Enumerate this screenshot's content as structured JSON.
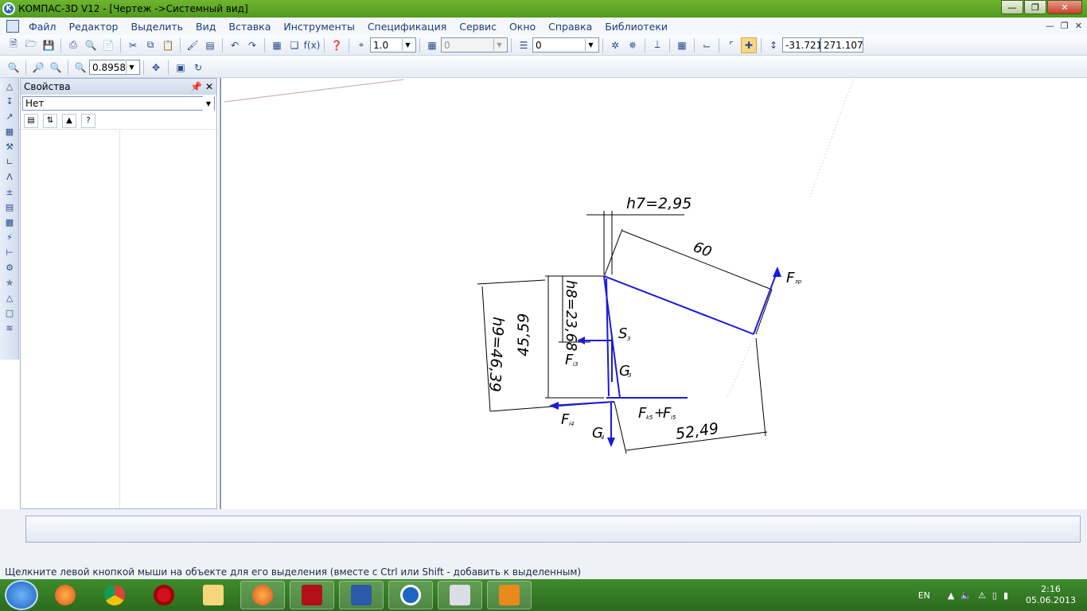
{
  "window": {
    "title": "КОМПАС-3D V12 - [Чертеж ->Системный вид]"
  },
  "menu": [
    "Файл",
    "Редактор",
    "Выделить",
    "Вид",
    "Вставка",
    "Инструменты",
    "Спецификация",
    "Сервис",
    "Окно",
    "Справка",
    "Библиотеки"
  ],
  "toolbar": {
    "step_value": "1.0",
    "layer_value": "0",
    "style_value": "0",
    "coord_x": "-31.721",
    "coord_y": "271.107"
  },
  "toolbar2": {
    "zoom_value": "0.8958"
  },
  "properties": {
    "title": "Свойства",
    "selector_value": "Нет"
  },
  "drawing": {
    "labels": {
      "h7": "h7=2,95",
      "dim60": "60",
      "h8": "h8=23,68",
      "dim4559": "45,59",
      "h9": "h9=46,39",
      "dim5249": "52,49",
      "f_zr": "F",
      "f_zr_sub": "зр",
      "s3": "S",
      "s3_sub": "3",
      "f_i3": "F",
      "f_i3_sub": "i3",
      "g3": "G",
      "g3_sub": "3",
      "f_k_f_i5": "F",
      "f_k_sub": "k5",
      "plus": "+",
      "f_i5": "F",
      "f_i5_sub": "i5",
      "f_i4": "F",
      "f_i4_sub": "i4",
      "g4": "G",
      "g4_sub": "4"
    }
  },
  "statusbar": {
    "hint": "Щелкните левой кнопкой мыши на объекте для его выделения (вместе с Ctrl или Shift - добавить к выделенным)"
  },
  "taskbar": {
    "lang": "EN",
    "time": "2:16",
    "date": "05.06.2013"
  }
}
